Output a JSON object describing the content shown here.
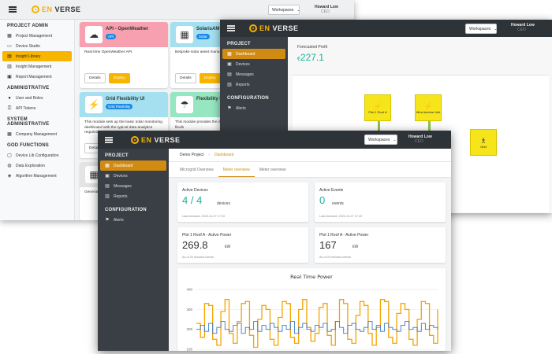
{
  "brand": {
    "name_prefix": "EN",
    "name_suffix": "VERSE",
    "accent": "#f7b500",
    "accent_dark": "#d18b13",
    "positive": "#19b394"
  },
  "back_window": {
    "workspaces_label": "Workspaces",
    "user": {
      "name": "Howard Low",
      "role": "CEO"
    },
    "sidebar": {
      "sections": [
        {
          "title": "PROJECT ADMIN",
          "items": [
            {
              "icon": "grid-icon",
              "label": "Project Management"
            },
            {
              "icon": "monitor-icon",
              "label": "Device Studio"
            },
            {
              "icon": "library-icon",
              "label": "Insight Library",
              "active": true
            },
            {
              "icon": "chart-icon",
              "label": "Insight Management"
            },
            {
              "icon": "report-icon",
              "label": "Report Management"
            }
          ]
        },
        {
          "title": "ADMINISTRATIVE",
          "items": [
            {
              "icon": "users-icon",
              "label": "User and Roles"
            },
            {
              "icon": "key-icon",
              "label": "API Tokens"
            }
          ]
        },
        {
          "title": "SYSTEM ADMINISTRATIVE",
          "items": [
            {
              "icon": "building-icon",
              "label": "Company Management"
            }
          ]
        },
        {
          "title": "GOD FUNCTIONS",
          "items": [
            {
              "icon": "device-icon",
              "label": "Device Lib Configuration"
            },
            {
              "icon": "explore-icon",
              "label": "Data Exploration"
            },
            {
              "icon": "algorithm-icon",
              "label": "Algorithm Management"
            }
          ]
        }
      ]
    },
    "cards": [
      {
        "title": "API - OpenWeather",
        "tag": "API",
        "desc": "Real time OpenWeather API.",
        "header_color": "#f7a1b0",
        "details": "Details",
        "deploy": "Deploy"
      },
      {
        "title": "SolarisAM - S",
        "tag": "Solar",
        "desc": "Bespoke solar asset mana AM.",
        "header_color": "#a4e0f0",
        "details": "Details",
        "deploy": "Deploy"
      },
      {
        "title": "Grid Flexibility UI",
        "tag": "Grid Flexibility",
        "desc": "This module sets up the basic solar monitoring dashboard with the typical data analytics required",
        "header_color": "#a4e0f0",
        "details": "Details",
        "deploy": "Deploy"
      },
      {
        "title": "Flexibility Dis",
        "tag": "",
        "desc": "This module provides the demonstration of grid flexib",
        "header_color": "#96e6c2",
        "details": "Details",
        "deploy": "Deploy"
      },
      {
        "title": "",
        "tag": "",
        "desc": "Generat Module",
        "header_color": "#e4e4e4",
        "details": "",
        "deploy": ""
      }
    ]
  },
  "middle_window": {
    "workspaces_label": "Workspaces",
    "user": {
      "name": "Howard Low",
      "role": "CEO"
    },
    "sidebar": {
      "project_title": "PROJECT",
      "items": [
        {
          "icon": "dashboard-icon",
          "label": "Dashboard",
          "active": true
        },
        {
          "icon": "devices-icon",
          "label": "Devices"
        },
        {
          "icon": "messages-icon",
          "label": "Messages"
        },
        {
          "icon": "reports-icon",
          "label": "Reports"
        }
      ],
      "config_title": "CONFIGURATION",
      "config_items": [
        {
          "icon": "alerts-icon",
          "label": "Alerts"
        }
      ]
    },
    "forecasted_profit": {
      "label": "Forecasted Profit",
      "currency": "€",
      "value": "227.1"
    },
    "nodes": [
      {
        "label": "Plot 1 Roof A",
        "icon": "solar-icon"
      },
      {
        "label": "Wind turbine Unit",
        "icon": "solar-icon"
      },
      {
        "label": "Grid",
        "icon": "grid-tower-icon"
      }
    ]
  },
  "front_window": {
    "workspaces_label": "Workspaces",
    "user": {
      "name": "Howard Low",
      "role": "CEO"
    },
    "sidebar": {
      "project_title": "PROJECT",
      "items": [
        {
          "icon": "dashboard-icon",
          "label": "Dashboard",
          "active": true
        },
        {
          "icon": "devices-icon",
          "label": "Devices"
        },
        {
          "icon": "messages-icon",
          "label": "Messages"
        },
        {
          "icon": "reports-icon",
          "label": "Reports"
        }
      ],
      "config_title": "CONFIGURATION",
      "config_items": [
        {
          "icon": "alerts-icon",
          "label": "Alerts"
        }
      ]
    },
    "breadcrumb": {
      "project": "Demo Project",
      "current": "Dashboard"
    },
    "tabs": [
      {
        "label": "Microgrid Overview"
      },
      {
        "label": "Meter overview",
        "active": true
      },
      {
        "label": "Meter overview"
      }
    ],
    "kpis": [
      {
        "label": "Active Devices",
        "value": "4 / 4",
        "unit": "devices",
        "note": "Last checked: 2023-11-07 17:20",
        "green": true
      },
      {
        "label": "Active Events",
        "value": "0",
        "unit": "events",
        "note": "Last checked: 2023-11-07 17:20",
        "green": true
      },
      {
        "label": "Plot 1 Roof A - Active Power",
        "value": "269.8",
        "unit": "kW",
        "note": "As of 20 minutes before",
        "green": false
      },
      {
        "label": "Plot 1 Roof A - Active Power",
        "value": "167",
        "unit": "kW",
        "note": "As of 20 minutes before",
        "green": false
      }
    ]
  },
  "chart_data": {
    "type": "line",
    "title": "Real Time Power",
    "ylim": [
      100,
      420
    ],
    "yticks": [
      "400",
      "300",
      "200",
      "100"
    ],
    "grid": true,
    "series": [
      {
        "color": "#f5a300",
        "values": [
          230,
          160,
          330,
          320,
          150,
          120,
          290,
          350,
          180,
          130,
          240,
          330,
          340,
          170,
          110,
          250,
          320,
          300,
          150,
          120,
          260,
          340,
          330,
          160,
          130,
          300,
          350,
          210,
          140,
          180,
          310,
          330,
          170,
          120,
          240,
          350,
          330,
          150,
          130,
          270,
          340,
          320,
          180,
          120,
          210,
          350,
          340,
          160,
          130,
          280,
          330,
          300,
          150,
          120,
          250,
          340,
          330,
          170,
          130,
          300
        ]
      },
      {
        "color": "#3a7bc8",
        "values": [
          200,
          220,
          190,
          230,
          180,
          210,
          240,
          200,
          190,
          220,
          230,
          180,
          210,
          200,
          240,
          190,
          220,
          200,
          230,
          210,
          190,
          220,
          200,
          240,
          180,
          210,
          230,
          200,
          190,
          220,
          210,
          230,
          190,
          200,
          240,
          210,
          180,
          220,
          230,
          200,
          190,
          210,
          240,
          200,
          220,
          190,
          230,
          210,
          200,
          190,
          220,
          240,
          200,
          210,
          190,
          230,
          200,
          220,
          210,
          200
        ]
      }
    ]
  }
}
